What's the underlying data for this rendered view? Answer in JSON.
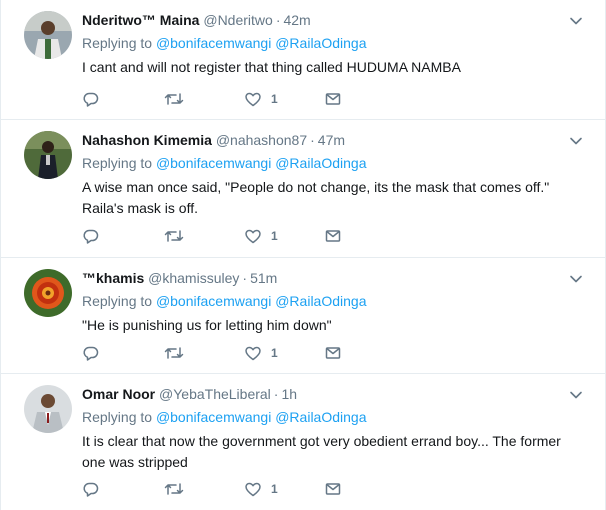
{
  "tweets": [
    {
      "fullname": "Nderitwo™ Maina",
      "handle": "@Nderitwo",
      "separator": "·",
      "time": "42m",
      "replying_prefix": "Replying to",
      "mentions": [
        "@bonifacemwangi",
        "@RailaOdinga"
      ],
      "text": "I cant and will not register that thing called HUDUMA NAMBA",
      "like_count": "1"
    },
    {
      "fullname": "Nahashon Kimemia",
      "handle": "@nahashon87",
      "separator": "·",
      "time": "47m",
      "replying_prefix": "Replying to",
      "mentions": [
        "@bonifacemwangi",
        "@RailaOdinga"
      ],
      "text": "A wise man once said, \"People do not change, its the mask that comes off.\" Raila's mask is off.",
      "like_count": "1"
    },
    {
      "fullname": "™khamis",
      "handle": "@khamissuley",
      "separator": "·",
      "time": "51m",
      "replying_prefix": "Replying to",
      "mentions": [
        "@bonifacemwangi",
        "@RailaOdinga"
      ],
      "text": "\"He is punishing us for letting him down\"",
      "like_count": "1"
    },
    {
      "fullname": "Omar Noor",
      "handle": "@YebaTheLiberal",
      "separator": "·",
      "time": "1h",
      "replying_prefix": "Replying to",
      "mentions": [
        "@bonifacemwangi",
        "@RailaOdinga"
      ],
      "text": "It is clear that now the government got very obedient errand boy... The former one was stripped",
      "like_count": "1"
    }
  ],
  "icons": {
    "reply": "reply-icon",
    "retweet": "retweet-icon",
    "like": "heart-icon",
    "dm": "envelope-icon",
    "caret": "chevron-down-icon"
  },
  "colors": {
    "link": "#1da1f2",
    "secondary_text": "#657786",
    "primary_text": "#14171a",
    "divider": "#e6ecf0"
  }
}
